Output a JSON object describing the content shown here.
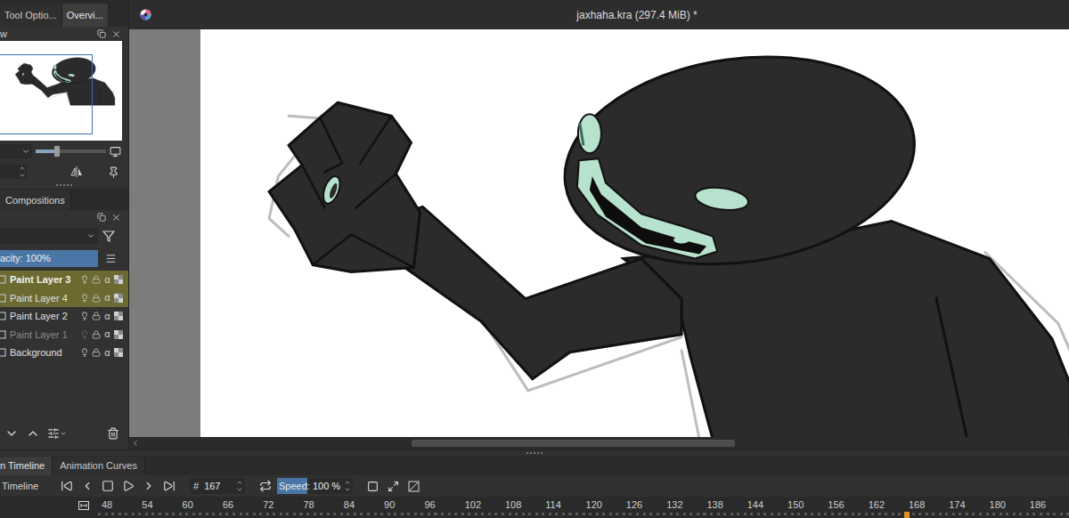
{
  "window": {
    "title": "jaxhaha.kra (297.4 MiB) *"
  },
  "dock_tabs": [
    {
      "label": "Tool Optio...",
      "selected": false
    },
    {
      "label": "Overvi...",
      "selected": true
    }
  ],
  "overview": {
    "title": "w",
    "zoom_level": 0.3
  },
  "compositions_tab": {
    "label": "Compositions"
  },
  "layers": {
    "opacity": "acity: 100%",
    "opacity_level": 1,
    "alpha_glyph": "α",
    "items": [
      {
        "name": "Paint Layer 3",
        "selected": true,
        "current": true,
        "visible": true
      },
      {
        "name": "Paint Layer 4",
        "selected": true,
        "current": false,
        "visible": true
      },
      {
        "name": "Paint Layer 2",
        "selected": false,
        "current": false,
        "visible": true
      },
      {
        "name": "Paint Layer 1",
        "selected": false,
        "current": false,
        "visible": false
      },
      {
        "name": "Background",
        "selected": false,
        "current": false,
        "visible": true
      }
    ]
  },
  "timeline": {
    "tabs": [
      {
        "label": "n Timeline",
        "selected": true
      },
      {
        "label": "Animation Curves",
        "selected": false
      }
    ],
    "label": "Timeline",
    "frame_prefix": "#",
    "frame": "167",
    "speed": "Speed: 100 %",
    "speed_level": 0.4,
    "ruler": [
      "48",
      "54",
      "60",
      "66",
      "72",
      "78",
      "84",
      "90",
      "96",
      "102",
      "108",
      "114",
      "120",
      "126",
      "132",
      "138",
      "144",
      "150",
      "156",
      "162",
      "168",
      "174",
      "180",
      "186"
    ]
  }
}
